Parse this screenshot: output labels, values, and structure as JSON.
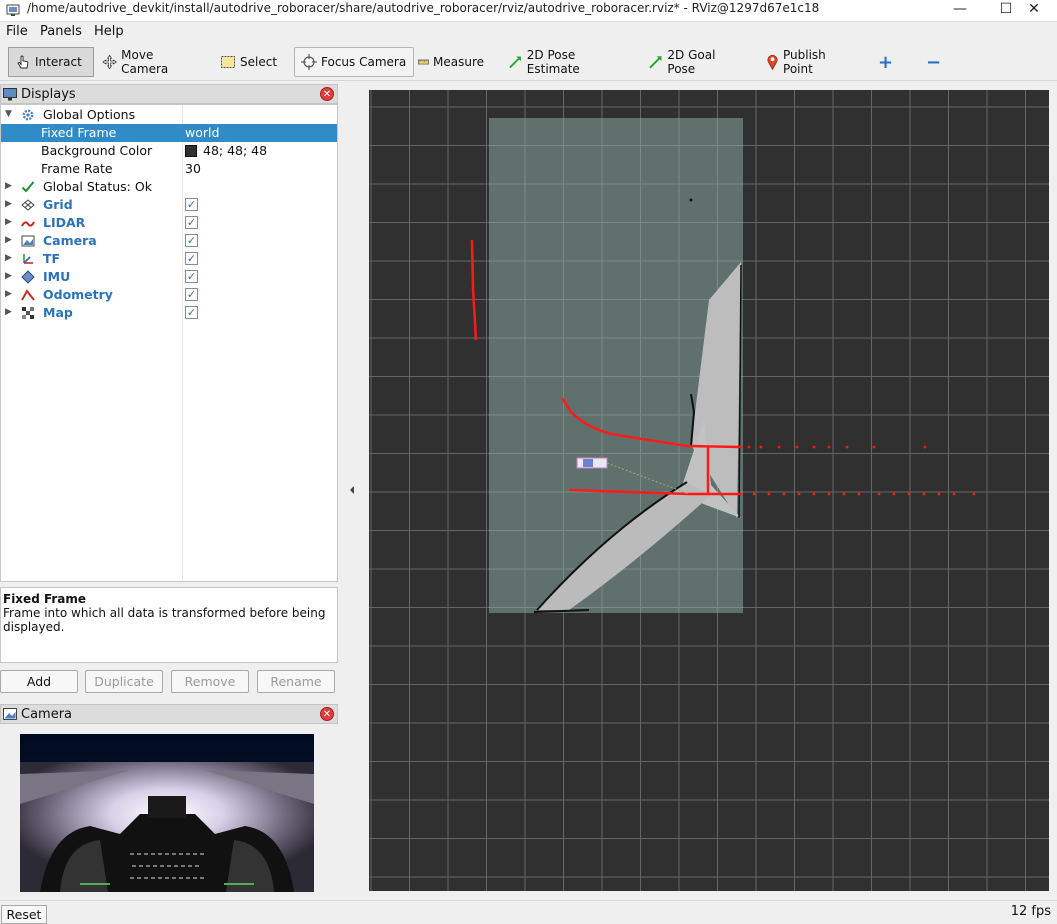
{
  "window": {
    "title": "/home/autodrive_devkit/install/autodrive_roboracer/share/autodrive_roboracer/rviz/autodrive_roboracer.rviz* - RViz@1297d67e1c18",
    "minimize": "—",
    "maximize": "☐",
    "close": "✕"
  },
  "menu": {
    "file": "File",
    "panels": "Panels",
    "help": "Help"
  },
  "toolbar": {
    "interact": "Interact",
    "move_camera": "Move Camera",
    "select": "Select",
    "focus_camera": "Focus Camera",
    "measure": "Measure",
    "pose_estimate": "2D Pose Estimate",
    "goal_pose": "2D Goal Pose",
    "publish_point": "Publish Point",
    "add_tool": "+",
    "remove_tool": "−"
  },
  "displays_panel": {
    "title": "Displays",
    "global_options": "Global Options",
    "fixed_frame": {
      "name": "Fixed Frame",
      "value": "world"
    },
    "background_color": {
      "name": "Background Color",
      "value": "48; 48; 48",
      "color": "#303030"
    },
    "frame_rate": {
      "name": "Frame Rate",
      "value": "30"
    },
    "global_status": "Global Status: Ok",
    "items": [
      {
        "label": "Grid",
        "checked": true,
        "icon": "grid-icon"
      },
      {
        "label": "LIDAR",
        "checked": true,
        "icon": "lidar-icon"
      },
      {
        "label": "Camera",
        "checked": true,
        "icon": "camera-icon"
      },
      {
        "label": "TF",
        "checked": true,
        "icon": "tf-icon"
      },
      {
        "label": "IMU",
        "checked": true,
        "icon": "imu-icon"
      },
      {
        "label": "Odometry",
        "checked": true,
        "icon": "odometry-icon"
      },
      {
        "label": "Map",
        "checked": true,
        "icon": "map-icon"
      }
    ],
    "check_mark": "✓"
  },
  "description": {
    "title": "Fixed Frame",
    "text": "Frame into which all data is transformed before being displayed."
  },
  "buttons": {
    "add": "Add",
    "duplicate": "Duplicate",
    "remove": "Remove",
    "rename": "Rename"
  },
  "camera_panel": {
    "title": "Camera"
  },
  "status": {
    "reset": "Reset",
    "fps": "12 fps"
  },
  "colors": {
    "selection": "#308cc6",
    "viewport_bg": "#303030",
    "grid_line": "#6a6a6a",
    "map_free": "#5f706d",
    "laser": "#ff1a1a"
  }
}
